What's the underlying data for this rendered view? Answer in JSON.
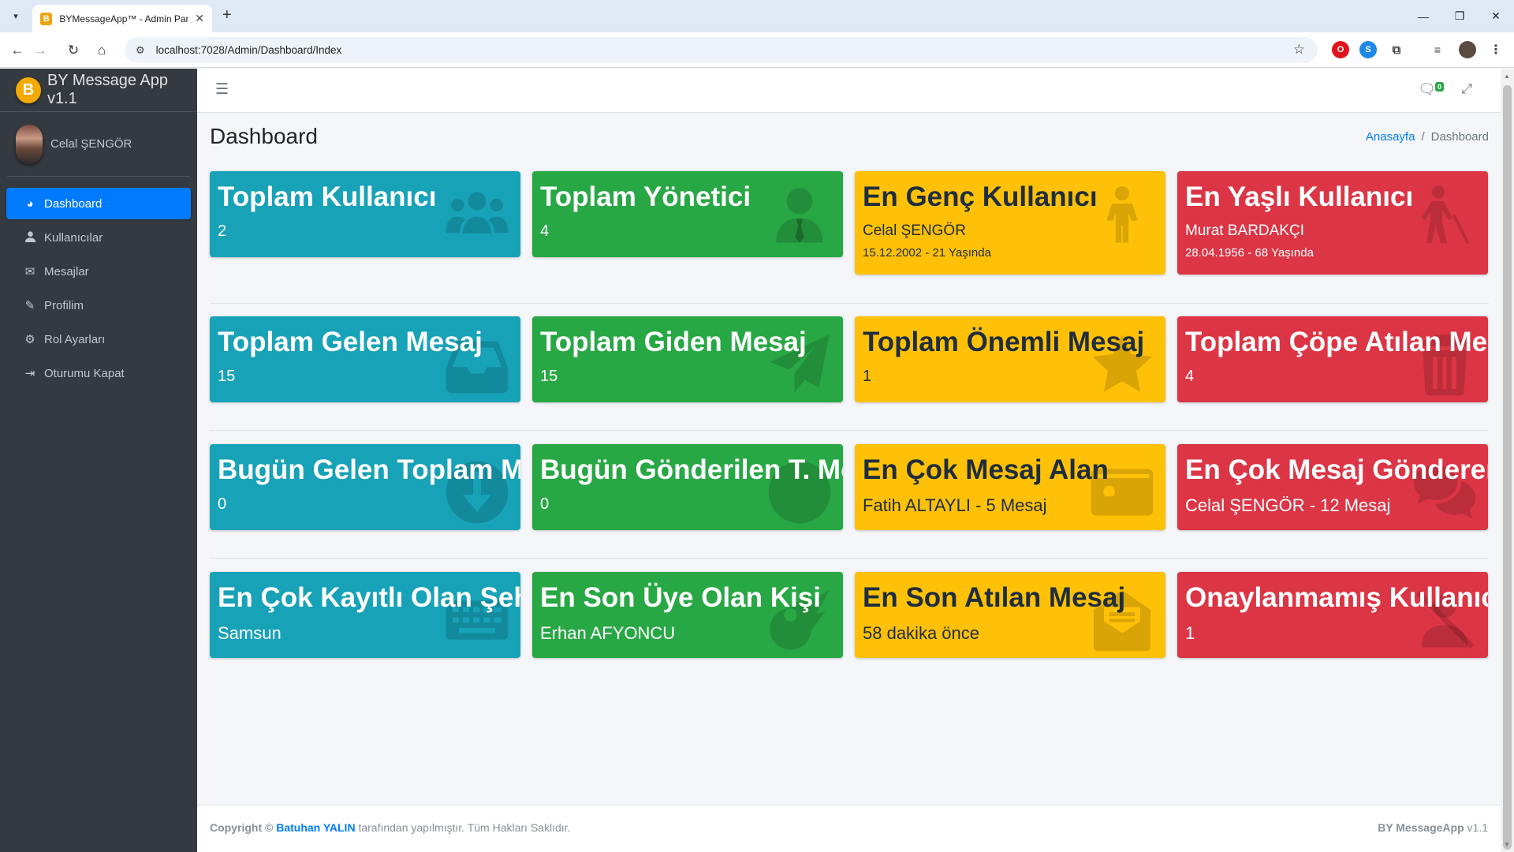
{
  "browser": {
    "tab_title": "BYMessageApp™ - Admin Panel",
    "tab_favicon": "B",
    "url": "localhost:7028/Admin/Dashboard/Index"
  },
  "sidebar": {
    "brand": "BY Message App v1.1",
    "brand_logo": "B",
    "user_name": "Celal ŞENGÖR",
    "items": [
      {
        "label": "Dashboard",
        "icon": "palette-icon",
        "glyph": "◕",
        "active": true
      },
      {
        "label": "Kullanıcılar",
        "icon": "user-icon",
        "glyph": "👤",
        "active": false
      },
      {
        "label": "Mesajlar",
        "icon": "envelope-icon",
        "glyph": "✉",
        "active": false
      },
      {
        "label": "Profilim",
        "icon": "user-pen-icon",
        "glyph": "✎",
        "active": false
      },
      {
        "label": "Rol Ayarları",
        "icon": "gears-icon",
        "glyph": "⚙",
        "active": false
      },
      {
        "label": "Oturumu Kapat",
        "icon": "sign-out-icon",
        "glyph": "⇥",
        "active": false
      }
    ]
  },
  "navbar": {
    "message_badge": "0"
  },
  "header": {
    "title": "Dashboard",
    "breadcrumb_home": "Anasayfa",
    "breadcrumb_current": "Dashboard"
  },
  "colors": {
    "info": "#17a2b8",
    "success": "#28a745",
    "warning": "#ffc107",
    "danger": "#dc3545",
    "primary": "#007bff"
  },
  "cards": {
    "total_users": {
      "title": "Toplam Kullanıcı",
      "value": "2",
      "icon": "users-icon"
    },
    "total_admins": {
      "title": "Toplam Yönetici",
      "value": "4",
      "icon": "user-tie-icon"
    },
    "youngest_user": {
      "title": "En Genç Kullanıcı",
      "name": "Celal ŞENGÖR",
      "detail": "15.12.2002 - 21 Yaşında",
      "icon": "child-icon"
    },
    "oldest_user": {
      "title": "En Yaşlı Kullanıcı",
      "name": "Murat BARDAKÇI",
      "detail": "28.04.1956 - 68 Yaşında",
      "icon": "person-cane-icon"
    },
    "total_incoming": {
      "title": "Toplam Gelen Mesaj",
      "value": "15",
      "icon": "inbox-icon"
    },
    "total_outgoing": {
      "title": "Toplam Giden Mesaj",
      "value": "15",
      "icon": "paper-plane-icon"
    },
    "total_important": {
      "title": "Toplam Önemli Mesaj",
      "value": "1",
      "icon": "star-icon"
    },
    "total_trashed": {
      "title": "Toplam Çöpe Atılan Mesaj",
      "value": "4",
      "icon": "trash-icon"
    },
    "today_incoming": {
      "title": "Bugün Gelen Toplam Mesaj",
      "value": "0",
      "icon": "arrow-down-circle-icon"
    },
    "today_sent": {
      "title": "Bugün Gönderilen T. Mesaj",
      "value": "0",
      "icon": "arrow-up-circle-icon"
    },
    "most_received": {
      "title": "En Çok Mesaj Alan",
      "value": "Fatih ALTAYLI - 5 Mesaj",
      "icon": "id-card-icon"
    },
    "most_sent": {
      "title": "En Çok Mesaj Gönderen",
      "value": "Celal ŞENGÖR - 12 Mesaj",
      "icon": "comments-icon"
    },
    "top_city": {
      "title": "En Çok Kayıtlı Olan Şehir",
      "value": "Samsun",
      "icon": "keyboard-icon"
    },
    "newest_member": {
      "title": "En Son Üye Olan Kişi",
      "value": "Erhan AFYONCU",
      "icon": "meteor-icon"
    },
    "last_message": {
      "title": "En Son Atılan Mesaj",
      "value": "58 dakika önce",
      "icon": "envelope-open-icon"
    },
    "unapproved": {
      "title": "Onaylanmamış Kullanıcı",
      "value": "1",
      "icon": "user-slash-icon"
    }
  },
  "footer": {
    "copyright": "Copyright ©",
    "author": "Batuhan YALIN",
    "text": "tarafından yapılmıştır. Tüm Hakları Saklıdır.",
    "app_name": "BY MessageApp",
    "version": "v1.1"
  }
}
